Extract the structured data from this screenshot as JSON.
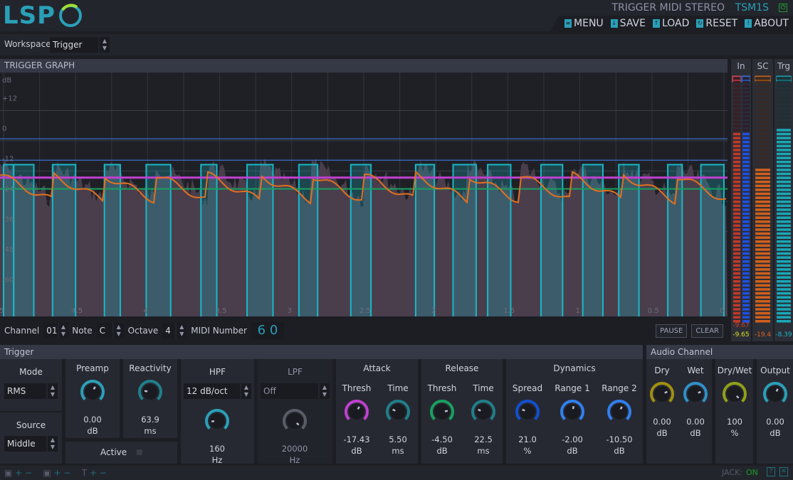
{
  "header": {
    "logo": "LSP",
    "title": "TRIGGER MIDI STEREO",
    "code": "TSM1S",
    "menu": [
      {
        "label": "MENU",
        "icon": "menu-icon"
      },
      {
        "label": "SAVE",
        "icon": "save-icon"
      },
      {
        "label": "LOAD",
        "icon": "load-icon"
      },
      {
        "label": "RESET",
        "icon": "reset-icon"
      },
      {
        "label": "ABOUT",
        "icon": "about-icon"
      }
    ]
  },
  "workspace": {
    "label": "Workspace",
    "value": "Trigger"
  },
  "graph": {
    "title": "TRIGGER GRAPH",
    "unit": "dB",
    "y_labels": [
      "+12",
      "0",
      "-12",
      "-24",
      "-36",
      "-48",
      "-60"
    ],
    "x_labels": [
      "5",
      "4.5",
      "4",
      "3.5",
      "3",
      "2.5",
      "2",
      "1.5",
      "1",
      "0.5",
      "0"
    ],
    "trigger_pulses_s": [
      [
        5.0,
        4.93
      ],
      [
        4.93,
        4.79
      ],
      [
        4.66,
        4.5
      ],
      [
        4.3,
        4.19
      ],
      [
        4.01,
        3.84
      ],
      [
        3.63,
        3.52
      ],
      [
        3.31,
        3.13
      ],
      [
        2.95,
        2.82
      ],
      [
        2.59,
        2.45
      ],
      [
        2.14,
        2.01
      ],
      [
        1.88,
        1.72
      ],
      [
        1.64,
        1.48
      ],
      [
        1.27,
        1.12
      ],
      [
        0.98,
        0.84
      ],
      [
        0.73,
        0.59
      ],
      [
        0.39,
        0.29
      ],
      [
        0.16,
        0.0
      ]
    ],
    "lines_db": {
      "attack_thresh": -17.43,
      "release_thresh": -21.93,
      "range1": -2.0,
      "range2": -10.5
    },
    "colors": {
      "pulse": "#18b8c8",
      "envelope": "#e07020",
      "attack": "#c040d0",
      "release": "#18a060",
      "range": "#4080f0"
    }
  },
  "meters": {
    "in": {
      "label": "In",
      "left": -9.67,
      "right": -9.65,
      "left_peak": "-9.67",
      "right_peak": "-9.65"
    },
    "sc": {
      "label": "SC",
      "value": -19.4,
      "text": "-19.4"
    },
    "trg": {
      "label": "Trg",
      "value": -8.39,
      "text": "-8.39"
    }
  },
  "controls": {
    "channel_label": "Channel",
    "channel": "01",
    "note_label": "Note",
    "note": "C",
    "octave_label": "Octave",
    "octave": "4",
    "midi_label": "MIDI Number",
    "midi": "6 0",
    "pause": "PAUSE",
    "clear": "CLEAR"
  },
  "trigger": {
    "title": "Trigger",
    "mode_label": "Mode",
    "mode": "RMS",
    "source_label": "Source",
    "source": "Middle",
    "active_label": "Active",
    "preamp": {
      "label": "Preamp",
      "value": "0.00",
      "unit": "dB",
      "pos": 0.6,
      "color": "#2aa0b8"
    },
    "reactivity": {
      "label": "Reactivity",
      "value": "63.9",
      "unit": "ms",
      "pos": 0.2,
      "color": "#1f7f8a"
    },
    "hpf": {
      "label": "HPF",
      "slope": "12 dB/oct",
      "value": "160",
      "unit": "Hz",
      "pos": 0.15,
      "color": "#2aa0b8"
    },
    "lpf": {
      "label": "LPF",
      "slope": "Off",
      "value": "20000",
      "unit": "Hz",
      "pos": 1.0,
      "color": "#5a5d68"
    },
    "attack": {
      "label": "Attack",
      "thresh": {
        "label": "Thresh",
        "value": "-17.43",
        "unit": "dB",
        "pos": 0.6,
        "color": "#c040d0"
      },
      "time": {
        "label": "Time",
        "value": "5.50",
        "unit": "ms",
        "pos": 0.25,
        "color": "#1f7f8a"
      }
    },
    "release": {
      "label": "Release",
      "thresh": {
        "label": "Thresh",
        "value": "-4.50",
        "unit": "dB",
        "pos": 0.8,
        "color": "#18a060"
      },
      "time": {
        "label": "Time",
        "value": "22.5",
        "unit": "ms",
        "pos": 0.25,
        "color": "#1f7f8a"
      }
    },
    "dynamics": {
      "label": "Dynamics",
      "spread": {
        "label": "Spread",
        "value": "21.0",
        "unit": "%",
        "pos": 0.25,
        "color": "#1050d0"
      },
      "range1": {
        "label": "Range 1",
        "value": "-2.00",
        "unit": "dB",
        "pos": 0.55,
        "color": "#3080f0"
      },
      "range2": {
        "label": "Range 2",
        "value": "-10.50",
        "unit": "dB",
        "pos": 0.6,
        "color": "#3080f0"
      }
    }
  },
  "audio": {
    "title": "Audio Channel",
    "dry": {
      "label": "Dry",
      "value": "0.00",
      "unit": "dB",
      "pos": 0.75,
      "color": "#a09010"
    },
    "wet": {
      "label": "Wet",
      "value": "0.00",
      "unit": "dB",
      "pos": 0.75,
      "color": "#3090c8"
    },
    "drywet": {
      "label": "Dry/Wet",
      "value": "100",
      "unit": "%",
      "pos": 1.0,
      "color": "#90a018"
    },
    "output": {
      "label": "Output",
      "value": "0.00",
      "unit": "dB",
      "pos": 0.6,
      "color": "#2aa0b8"
    }
  },
  "footer": {
    "jack_label": "JACK:",
    "jack_status": "ON"
  }
}
